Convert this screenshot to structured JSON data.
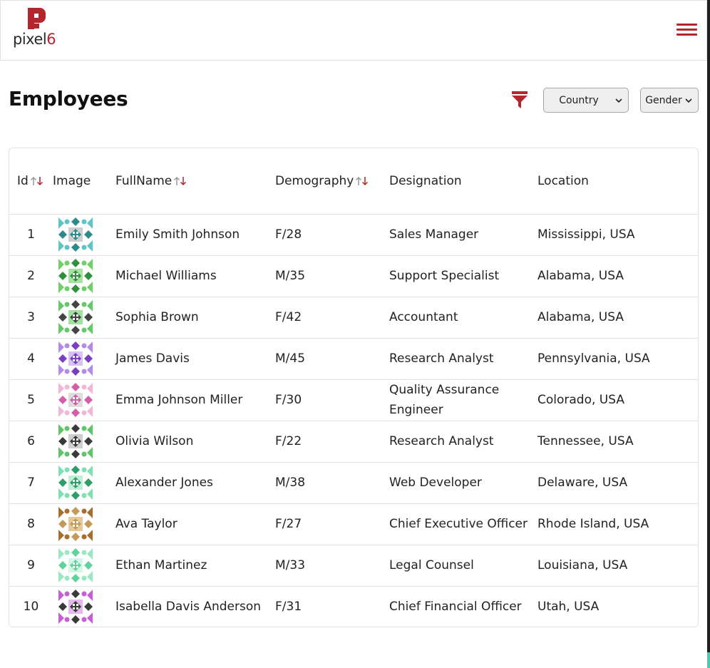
{
  "brand": {
    "logo_text_main": "pixel",
    "logo_text_accent": "6",
    "accent_color": "#b3262d"
  },
  "page": {
    "title": "Employees"
  },
  "filters": {
    "country_label": "Country",
    "gender_label": "Gender"
  },
  "table": {
    "columns": {
      "id": "Id",
      "image": "Image",
      "fullname": "FullName",
      "demography": "Demography",
      "designation": "Designation",
      "location": "Location"
    },
    "rows": [
      {
        "id": "1",
        "name": "Emily Smith Johnson",
        "demo": "F/28",
        "designation": "Sales Manager",
        "location": "Mississippi, USA",
        "avatar_icon": "teal-quilt-avatar"
      },
      {
        "id": "2",
        "name": "Michael Williams",
        "demo": "M/35",
        "designation": "Support Specialist",
        "location": "Alabama, USA",
        "avatar_icon": "green-quilt-avatar"
      },
      {
        "id": "3",
        "name": "Sophia Brown",
        "demo": "F/42",
        "designation": "Accountant",
        "location": "Alabama, USA",
        "avatar_icon": "green-gray-quilt-avatar"
      },
      {
        "id": "4",
        "name": "James Davis",
        "demo": "M/45",
        "designation": "Research Analyst",
        "location": "Pennsylvania, USA",
        "avatar_icon": "purple-quilt-avatar"
      },
      {
        "id": "5",
        "name": "Emma Johnson Miller",
        "demo": "F/30",
        "designation": "Quality Assurance Engineer",
        "location": "Colorado, USA",
        "avatar_icon": "pink-quilt-avatar"
      },
      {
        "id": "6",
        "name": "Olivia Wilson",
        "demo": "F/22",
        "designation": "Research Analyst",
        "location": "Tennessee, USA",
        "avatar_icon": "green-dark-quilt-avatar"
      },
      {
        "id": "7",
        "name": "Alexander Jones",
        "demo": "M/38",
        "designation": "Web Developer",
        "location": "Delaware, USA",
        "avatar_icon": "mint-quilt-avatar"
      },
      {
        "id": "8",
        "name": "Ava Taylor",
        "demo": "F/27",
        "designation": "Chief Executive Officer",
        "location": "Rhode Island, USA",
        "avatar_icon": "gold-quilt-avatar"
      },
      {
        "id": "9",
        "name": "Ethan Martinez",
        "demo": "M/33",
        "designation": "Legal Counsel",
        "location": "Louisiana, USA",
        "avatar_icon": "light-green-quilt-avatar"
      },
      {
        "id": "10",
        "name": "Isabella Davis Anderson",
        "demo": "F/31",
        "designation": "Chief Financial Officer",
        "location": "Utah, USA",
        "avatar_icon": "magenta-quilt-avatar"
      }
    ]
  }
}
